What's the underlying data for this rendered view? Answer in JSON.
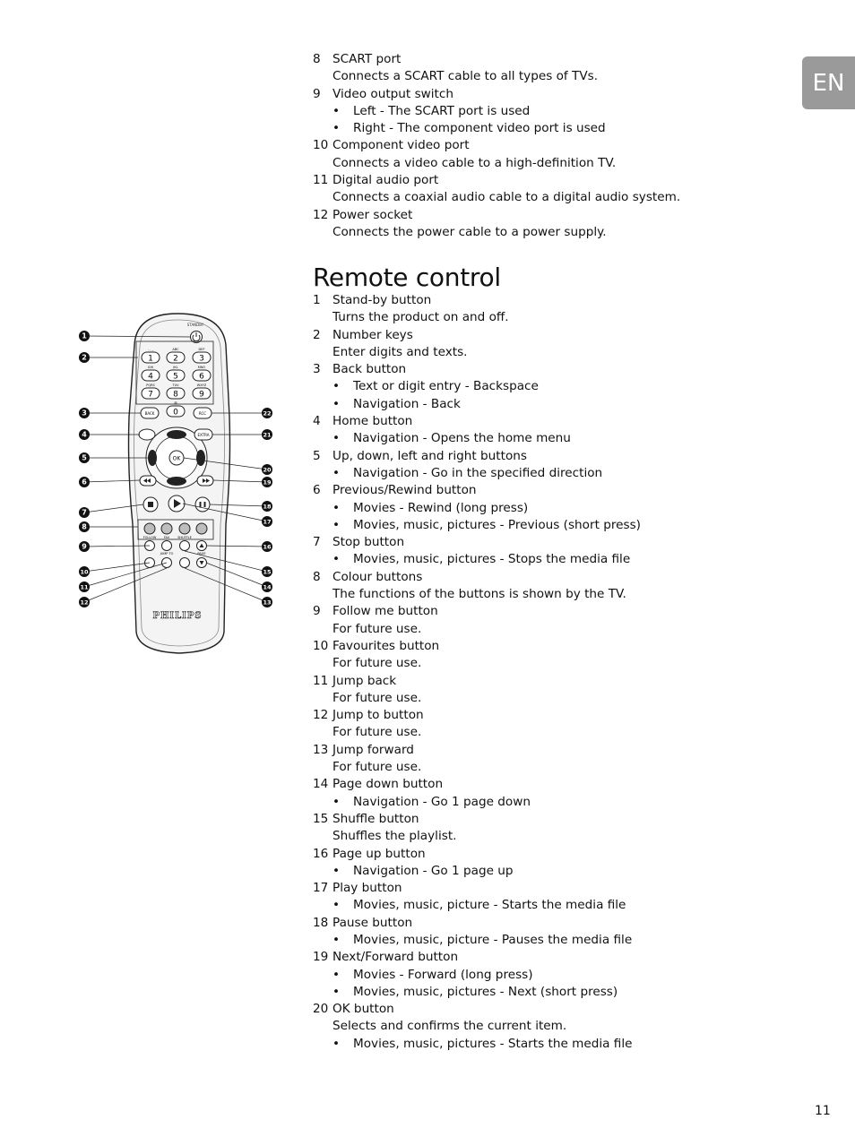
{
  "language_tab": "EN",
  "page_number": "11",
  "connectors": [
    {
      "num": "8",
      "title": "SCART port",
      "desc": "Connects a SCART cable to all types of TVs.",
      "bullets": []
    },
    {
      "num": "9",
      "title": "Video output switch",
      "desc": null,
      "bullets": [
        "Left - The SCART port is used",
        "Right - The component video port is used"
      ]
    },
    {
      "num": "10",
      "title": "Component video port",
      "desc": "Connects a video cable to a high-definition TV.",
      "bullets": []
    },
    {
      "num": "11",
      "title": "Digital audio port",
      "desc": "Connects a coaxial audio cable to a digital audio system.",
      "bullets": []
    },
    {
      "num": "12",
      "title": "Power socket",
      "desc": "Connects the power cable to a power supply.",
      "bullets": []
    }
  ],
  "remote_section": {
    "title": "Remote control",
    "items": [
      {
        "num": "1",
        "title": "Stand-by button",
        "desc": "Turns the product on and off.",
        "bullets": []
      },
      {
        "num": "2",
        "title": "Number keys",
        "desc": "Enter digits and texts.",
        "bullets": []
      },
      {
        "num": "3",
        "title": "Back button",
        "desc": null,
        "bullets": [
          "Text or digit entry - Backspace",
          "Navigation - Back"
        ]
      },
      {
        "num": "4",
        "title": "Home button",
        "desc": null,
        "bullets": [
          "Navigation - Opens the home menu"
        ]
      },
      {
        "num": "5",
        "title": "Up, down, left and right buttons",
        "desc": null,
        "bullets": [
          "Navigation - Go in the specified direction"
        ]
      },
      {
        "num": "6",
        "title": "Previous/Rewind button",
        "desc": null,
        "bullets": [
          "Movies - Rewind (long press)",
          "Movies, music, pictures - Previous (short press)"
        ]
      },
      {
        "num": "7",
        "title": "Stop button",
        "desc": null,
        "bullets": [
          "Movies, music, pictures - Stops the media file"
        ]
      },
      {
        "num": "8",
        "title": "Colour buttons",
        "desc": "The functions of the buttons is shown by the TV.",
        "bullets": []
      },
      {
        "num": "9",
        "title": "Follow me button",
        "desc": "For future use.",
        "bullets": []
      },
      {
        "num": "10",
        "title": "Favourites button",
        "desc": "For future use.",
        "bullets": []
      },
      {
        "num": "11",
        "title": "Jump back",
        "desc": "For future use.",
        "bullets": []
      },
      {
        "num": "12",
        "title": "Jump to button",
        "desc": "For future use.",
        "bullets": []
      },
      {
        "num": "13",
        "title": "Jump forward",
        "desc": "For future use.",
        "bullets": []
      },
      {
        "num": "14",
        "title": "Page down button",
        "desc": null,
        "bullets": [
          "Navigation - Go 1 page down"
        ]
      },
      {
        "num": "15",
        "title": "Shuffle button",
        "desc": "Shuffles the playlist.",
        "bullets": []
      },
      {
        "num": "16",
        "title": "Page up button",
        "desc": null,
        "bullets": [
          "Navigation - Go 1 page up"
        ]
      },
      {
        "num": "17",
        "title": "Play button",
        "desc": null,
        "bullets": [
          "Movies, music, picture - Starts the media file"
        ]
      },
      {
        "num": "18",
        "title": "Pause button",
        "desc": null,
        "bullets": [
          "Movies, music, picture - Pauses the media file"
        ]
      },
      {
        "num": "19",
        "title": "Next/Forward button",
        "desc": null,
        "bullets": [
          "Movies - Forward (long press)",
          "Movies, music, pictures - Next (short press)"
        ]
      },
      {
        "num": "20",
        "title": "OK button",
        "desc": "Selects and confirms the current item.",
        "bullets": [
          "Movies, music, pictures - Starts the media file"
        ]
      }
    ]
  },
  "remote_illustration": {
    "brand": "PHILIPS",
    "standby_label": "STANDBY",
    "keys": [
      {
        "digit": "1",
        "letters": ". , _"
      },
      {
        "digit": "2",
        "letters": "ABC"
      },
      {
        "digit": "3",
        "letters": "DEF"
      },
      {
        "digit": "4",
        "letters": "GHI"
      },
      {
        "digit": "5",
        "letters": "JKL"
      },
      {
        "digit": "6",
        "letters": "MNO"
      },
      {
        "digit": "7",
        "letters": "PQRS"
      },
      {
        "digit": "8",
        "letters": "TUV"
      },
      {
        "digit": "9",
        "letters": "WXYZ"
      },
      {
        "digit": "0",
        "letters": "@"
      }
    ],
    "back_label": "BACK",
    "right_label": "RCC",
    "home_right_label": "EXTRA",
    "ok_label": "OK",
    "bottom_labels": [
      "FOLLOW",
      "FAV",
      "SHUFFLE"
    ],
    "jump_label": "JUMP TO",
    "page_label": "PAGE",
    "left_callouts": [
      "1",
      "2",
      "3",
      "4",
      "5",
      "6",
      "7",
      "8",
      "9",
      "10",
      "11",
      "12"
    ],
    "right_callouts": [
      "22",
      "21",
      "20",
      "19",
      "18",
      "17",
      "16",
      "15",
      "14",
      "13"
    ]
  }
}
